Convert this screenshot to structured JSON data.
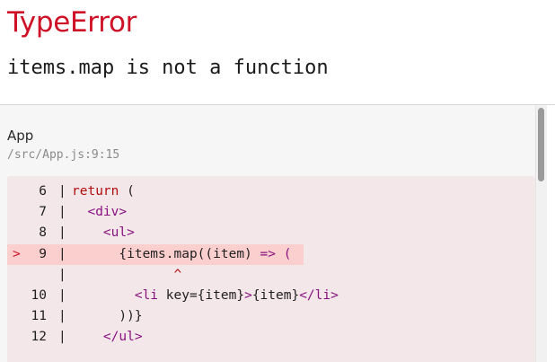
{
  "error": {
    "type": "TypeError",
    "message": "items.map is not a function"
  },
  "frame": {
    "name": "App",
    "location": "/src/App.js:9:15"
  },
  "code_lines": [
    {
      "marker": "",
      "num": "6",
      "sep": "|",
      "segments": [
        {
          "cls": "tok-kw",
          "text": "return"
        },
        {
          "cls": "tok-plain",
          "text": " ("
        }
      ]
    },
    {
      "marker": "",
      "num": "7",
      "sep": "|",
      "segments": [
        {
          "cls": "tok-plain",
          "text": "  "
        },
        {
          "cls": "tok-tag",
          "text": "<div>"
        }
      ]
    },
    {
      "marker": "",
      "num": "8",
      "sep": "|",
      "segments": [
        {
          "cls": "tok-plain",
          "text": "    "
        },
        {
          "cls": "tok-tag",
          "text": "<ul>"
        }
      ]
    },
    {
      "marker": ">",
      "num": "9",
      "sep": "|",
      "highlight": true,
      "segments": [
        {
          "cls": "tok-plain",
          "text": "      {items.map((item) "
        },
        {
          "cls": "tok-tag",
          "text": "=> ("
        }
      ]
    },
    {
      "marker": "",
      "num": "",
      "sep": "|",
      "segments": [
        {
          "cls": "tok-plain",
          "text": "             "
        },
        {
          "cls": "tok-kw",
          "text": "^"
        }
      ]
    },
    {
      "marker": "",
      "num": "10",
      "sep": "|",
      "segments": [
        {
          "cls": "tok-plain",
          "text": "        "
        },
        {
          "cls": "tok-tag",
          "text": "<li "
        },
        {
          "cls": "tok-plain",
          "text": "key={item}"
        },
        {
          "cls": "tok-tag",
          "text": ">"
        },
        {
          "cls": "tok-plain",
          "text": "{item}"
        },
        {
          "cls": "tok-tag",
          "text": "</li>"
        }
      ]
    },
    {
      "marker": "",
      "num": "11",
      "sep": "|",
      "segments": [
        {
          "cls": "tok-plain",
          "text": "      ))}"
        }
      ]
    },
    {
      "marker": "",
      "num": "12",
      "sep": "|",
      "segments": [
        {
          "cls": "tok-plain",
          "text": "    "
        },
        {
          "cls": "tok-tag",
          "text": "</ul>"
        }
      ]
    }
  ],
  "colors": {
    "error_red": "#ce1126",
    "code_bg": "#f4e7e9",
    "highlight_bg": "#fccfcf",
    "keyword": "#b10b0b",
    "tag": "#881280"
  }
}
